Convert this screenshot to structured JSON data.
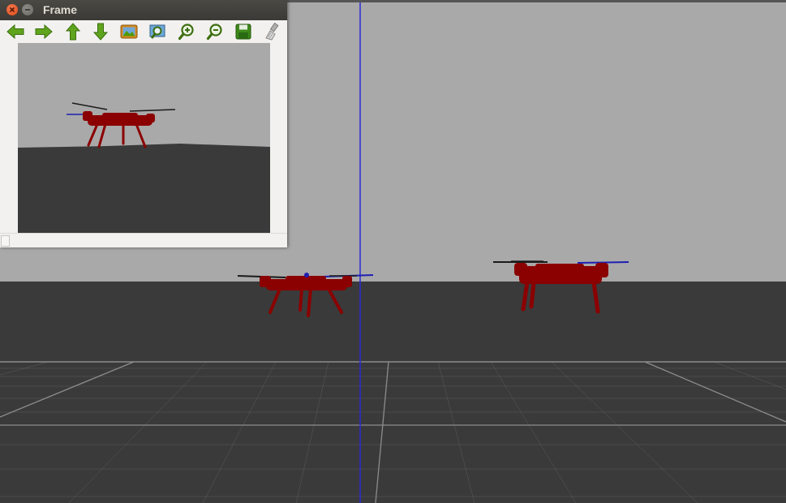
{
  "window": {
    "title": "Frame",
    "status_text": ""
  },
  "toolbar": {
    "items": [
      {
        "icon": "arrow-left-icon"
      },
      {
        "icon": "arrow-right-icon"
      },
      {
        "icon": "arrow-up-icon"
      },
      {
        "icon": "arrow-down-icon"
      },
      {
        "icon": "image-icon"
      },
      {
        "icon": "zoom-fit-icon"
      },
      {
        "icon": "zoom-in-icon"
      },
      {
        "icon": "zoom-out-icon"
      },
      {
        "icon": "save-icon"
      },
      {
        "icon": "clear-brush-icon"
      }
    ]
  },
  "scene": {
    "sky_color": "#a9a9a9",
    "ground_color": "#3a3a3a",
    "grid_color": "#8c8c8c",
    "axis_color": "#2b2bd6",
    "drone_color": "#8b0000",
    "propeller_color": "#1a1a1a",
    "propeller_accent": "#1f1fb3"
  },
  "window_colors": {
    "close": "#df4a16",
    "titlebar": "#3c3b37",
    "icon_green": "#4e9a06"
  }
}
